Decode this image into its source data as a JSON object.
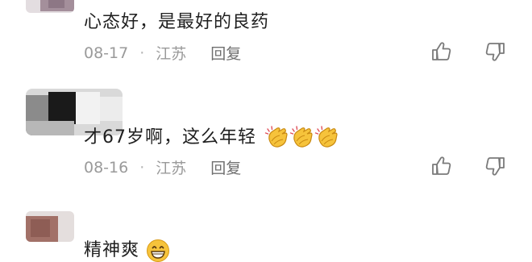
{
  "comments": [
    {
      "text": "心态好，是最好的良药",
      "date": "08-17",
      "separator": "·",
      "location": "江苏",
      "reply_label": "回复"
    },
    {
      "text": "才67岁啊，这么年轻",
      "emoji": "clapping-hands",
      "emoji_count": 3,
      "date": "08-16",
      "separator": "·",
      "location": "江苏",
      "reply_label": "回复"
    },
    {
      "text": "精神爽",
      "emoji": "grinning-face"
    }
  ],
  "icons": {
    "like": "thumbs-up-icon",
    "dislike": "thumbs-down-icon"
  },
  "colors": {
    "text": "#1f1f1f",
    "meta": "#9a9a9a",
    "reply": "#6f6f6f",
    "emoji": "#f6c33b"
  }
}
